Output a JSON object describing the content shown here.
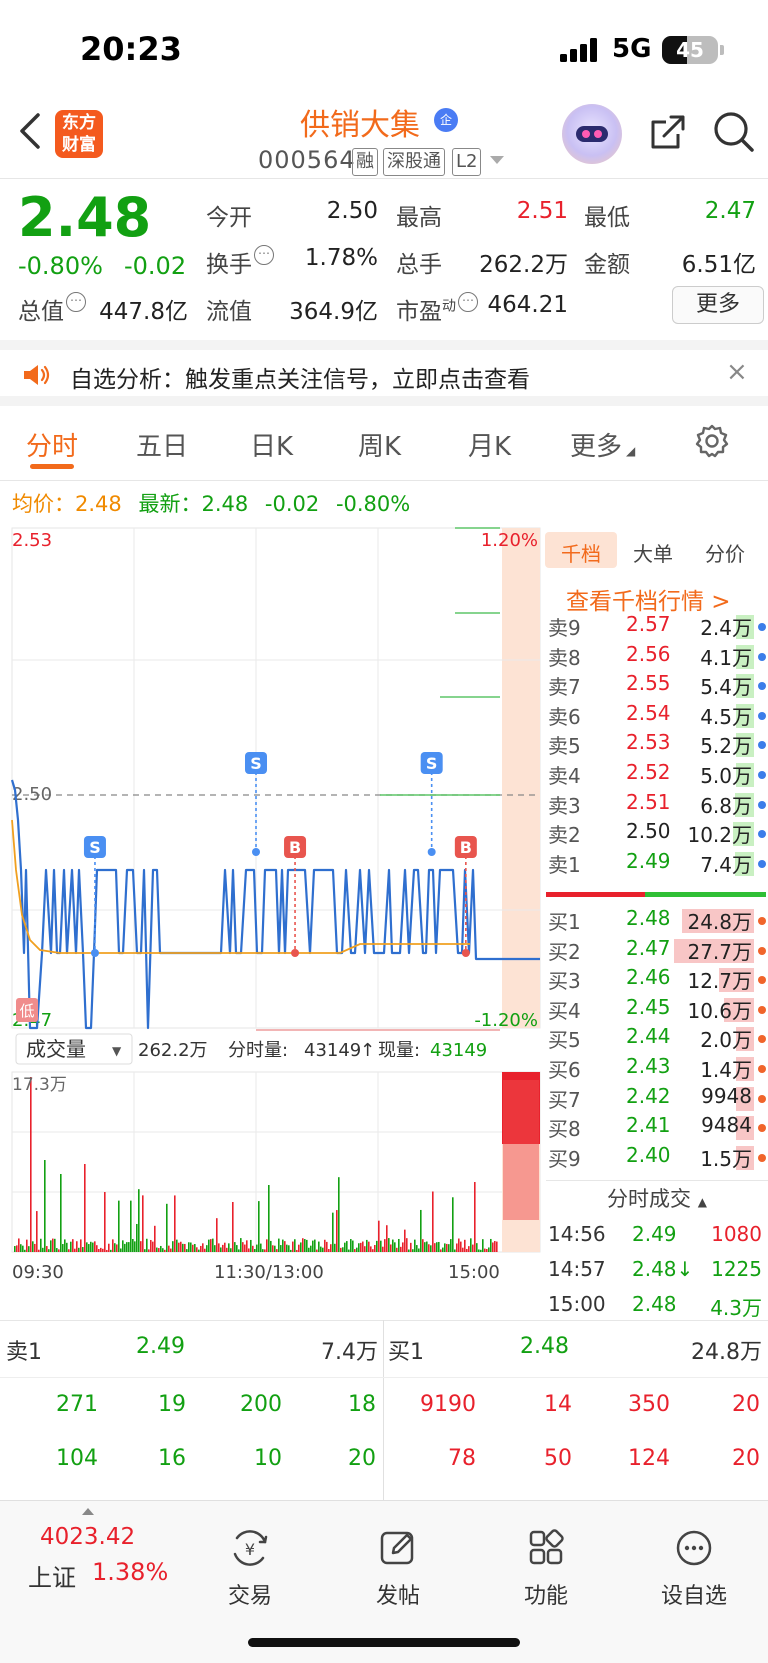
{
  "status": {
    "time": "20:23",
    "network": "5G",
    "battery": "45",
    "battery_level": 45
  },
  "header": {
    "logo": "东方财富",
    "stock_name": "供销大集",
    "ent_badge": "企",
    "code": "000564",
    "tags": [
      "融",
      "深股通",
      "L2"
    ]
  },
  "quote": {
    "price": "2.48",
    "change_pct": "-0.80%",
    "change_amt": "-0.02",
    "fields": [
      {
        "label": "今开",
        "value": "2.50",
        "color": "#222222"
      },
      {
        "label": "最高",
        "value": "2.51",
        "color": "#e8212c"
      },
      {
        "label": "最低",
        "value": "2.47",
        "color": "#12a012"
      },
      {
        "label": "换手",
        "value": "1.78%",
        "color": "#222222"
      },
      {
        "label": "总手",
        "value": "262.2万",
        "color": "#222222"
      },
      {
        "label": "金额",
        "value": "6.51亿",
        "color": "#222222"
      },
      {
        "label": "总值",
        "value": "447.8亿",
        "color": "#222222"
      },
      {
        "label": "流值",
        "value": "364.9亿",
        "color": "#222222"
      },
      {
        "label": "市盈",
        "sup": "动",
        "value": "464.21",
        "color": "#222222"
      }
    ],
    "more_label": "更多"
  },
  "alert": {
    "text": "自选分析：触发重点关注信号，立即点击查看",
    "close": "×"
  },
  "tabs": [
    "分时",
    "五日",
    "日K",
    "周K",
    "月K",
    "更多"
  ],
  "avg_row": {
    "avg_label": "均价：",
    "avg_value": "2.48",
    "latest_label": "最新：",
    "latest_value": "2.48",
    "latest_chg": "-0.02",
    "latest_pct": "-0.80%"
  },
  "chart_data": {
    "type": "line",
    "price_axis": {
      "max": "2.53",
      "mid": "2.50",
      "min": "2.47",
      "pct_max": "1.20%",
      "pct_min": "-1.20%"
    },
    "low_marker": "低",
    "volume_selector": "成交量",
    "volume_summary": {
      "total": "262.2万",
      "interval_label": "分时量:",
      "interval_value": "43149",
      "arrow": "↑",
      "current_label": "现量:",
      "current_value": "43149"
    },
    "volume_axis_max": "17.3万",
    "time_ticks": [
      "09:30",
      "11:30/13:00",
      "15:00"
    ],
    "markers": [
      {
        "type": "S",
        "x": 0.17,
        "price": 2.48,
        "color": "#4a8ff2"
      },
      {
        "type": "S",
        "x": 0.5,
        "price": 2.49,
        "color": "#4a8ff2"
      },
      {
        "type": "B",
        "x": 0.58,
        "price": 2.48,
        "color": "#e8554e"
      },
      {
        "type": "S",
        "x": 0.86,
        "price": 2.49,
        "color": "#4a8ff2"
      },
      {
        "type": "B",
        "x": 0.93,
        "price": 2.48,
        "color": "#e8554e"
      }
    ]
  },
  "orderbook": {
    "tabs": [
      "千档",
      "大单",
      "分价"
    ],
    "link": "查看千档行情 >",
    "asks": [
      {
        "label": "卖9",
        "price": "2.57",
        "vol": "2.4万",
        "fill": 0.02
      },
      {
        "label": "卖8",
        "price": "2.56",
        "vol": "4.1万",
        "fill": 0.02
      },
      {
        "label": "卖7",
        "price": "2.55",
        "vol": "5.4万",
        "fill": 0.02
      },
      {
        "label": "卖6",
        "price": "2.54",
        "vol": "4.5万",
        "fill": 0.02
      },
      {
        "label": "卖5",
        "price": "2.53",
        "vol": "5.2万",
        "fill": 0.02
      },
      {
        "label": "卖4",
        "price": "2.52",
        "vol": "5.0万",
        "fill": 0.02
      },
      {
        "label": "卖3",
        "price": "2.51",
        "vol": "6.8万",
        "fill": 0.03
      },
      {
        "label": "卖2",
        "price": "2.50",
        "vol": "10.2万",
        "fill": 0.05
      },
      {
        "label": "卖1",
        "price": "2.49",
        "vol": "7.4万",
        "fill": 0.03
      }
    ],
    "bids": [
      {
        "label": "买1",
        "price": "2.48",
        "vol": "24.8万",
        "fill": 0.45
      },
      {
        "label": "买2",
        "price": "2.47",
        "vol": "27.7万",
        "fill": 0.5
      },
      {
        "label": "买3",
        "price": "2.46",
        "vol": "12.7万",
        "fill": 0.22
      },
      {
        "label": "买4",
        "price": "2.45",
        "vol": "10.6万",
        "fill": 0.19
      },
      {
        "label": "买5",
        "price": "2.44",
        "vol": "2.0万",
        "fill": 0.0
      },
      {
        "label": "买6",
        "price": "2.43",
        "vol": "1.4万",
        "fill": 0.0
      },
      {
        "label": "买7",
        "price": "2.42",
        "vol": "9948",
        "fill": 0.0
      },
      {
        "label": "买8",
        "price": "2.41",
        "vol": "9484",
        "fill": 0.0
      },
      {
        "label": "买9",
        "price": "2.40",
        "vol": "1.5万",
        "fill": 0.0
      }
    ],
    "colors": {
      "ask_bar": "#c9f0c2",
      "bid_bar": "#f8c6c6",
      "ask_dot": "#3b7de9",
      "bid_dot": "#f0642a"
    }
  },
  "ticks": {
    "header": "分时成交",
    "rows": [
      {
        "time": "14:56",
        "price": "2.49",
        "vol": "1080",
        "price_color": "#12a012",
        "vol_color": "#e8212c"
      },
      {
        "time": "14:57",
        "price": "2.48↓",
        "vol": "1225",
        "price_color": "#12a012",
        "vol_color": "#12a012"
      },
      {
        "time": "15:00",
        "price": "2.48",
        "vol": "4.3万",
        "price_color": "#12a012",
        "vol_color": "#12a012"
      }
    ]
  },
  "levels": {
    "sell_label": "卖1",
    "sell_price": "2.49",
    "sell_vol": "7.4万",
    "buy_label": "买1",
    "buy_price": "2.48",
    "buy_vol": "24.8万",
    "sell_rows": [
      [
        "271",
        "19",
        "200",
        "18"
      ],
      [
        "104",
        "16",
        "10",
        "20"
      ]
    ],
    "buy_rows": [
      [
        "9190",
        "14",
        "350",
        "20"
      ],
      [
        "78",
        "50",
        "124",
        "20"
      ]
    ]
  },
  "nav": {
    "index_value": "4023.42",
    "index_name": "上证",
    "index_pct": "1.38%",
    "items": [
      "交易",
      "发帖",
      "功能",
      "设自选"
    ]
  }
}
